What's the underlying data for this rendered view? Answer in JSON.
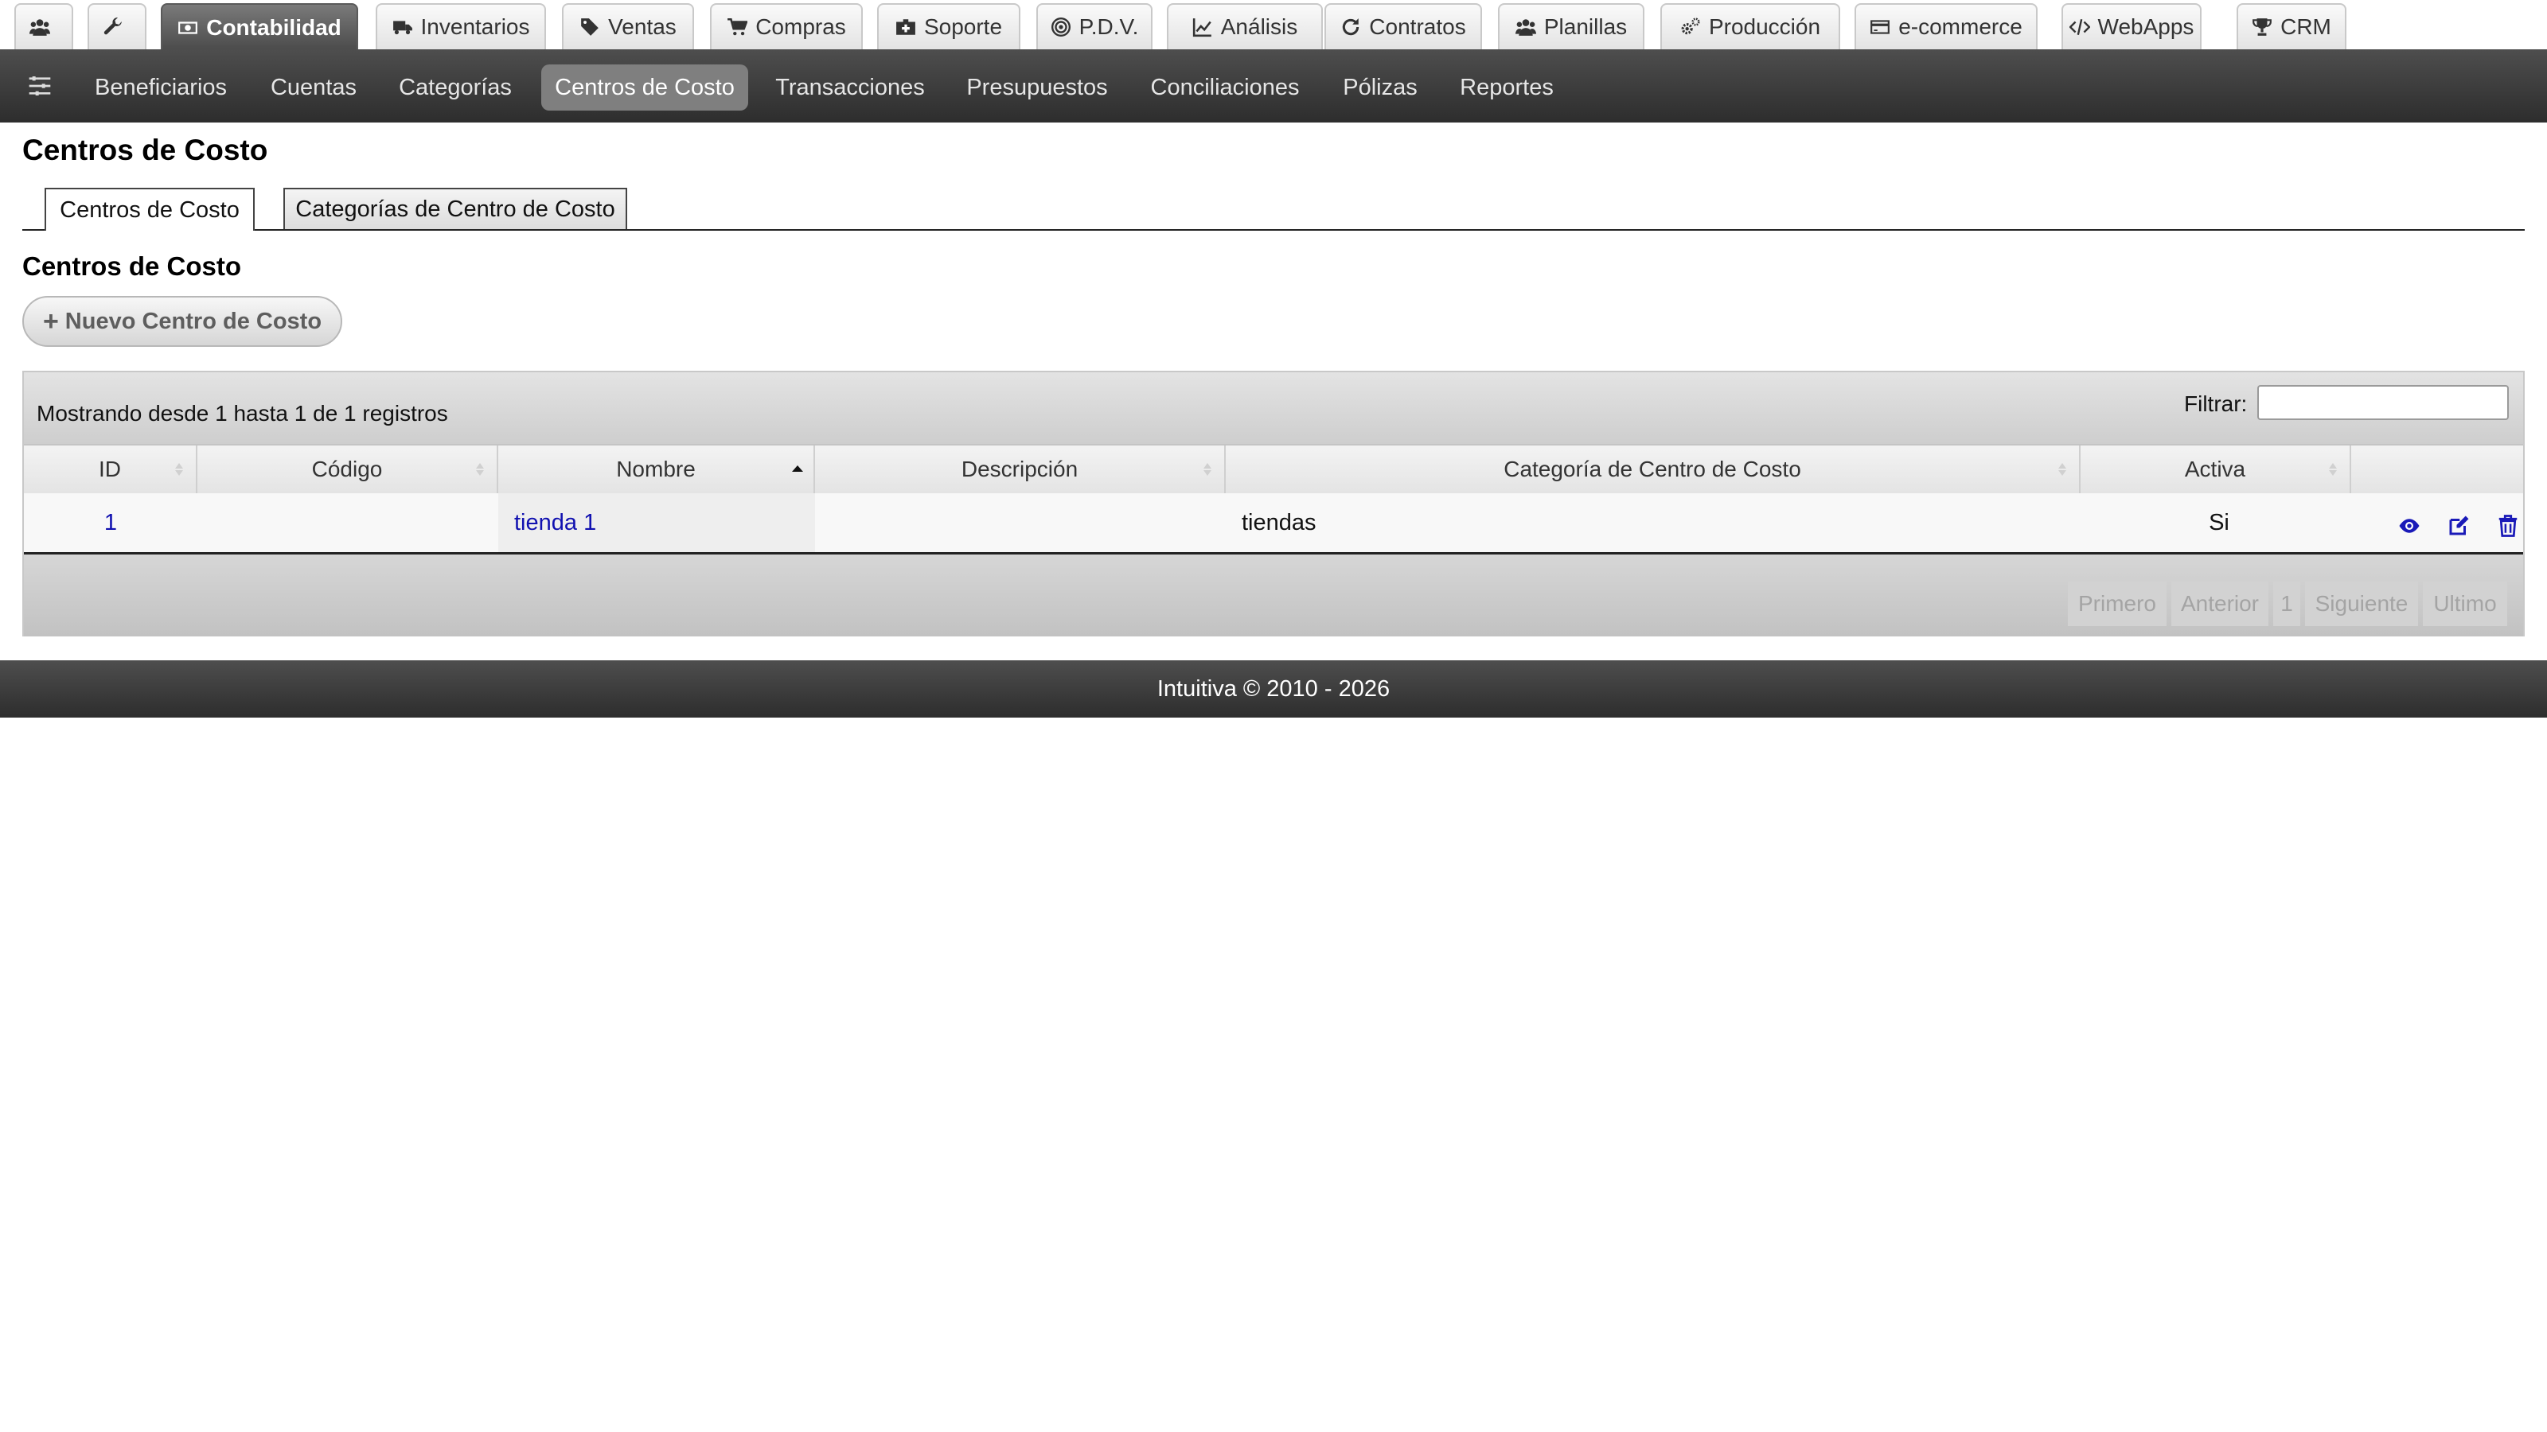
{
  "module_tabs": [
    {
      "label": "",
      "icon": "users-icon"
    },
    {
      "label": "",
      "icon": "wrench-icon"
    },
    {
      "label": "Contabilidad",
      "icon": "money-icon",
      "active": true
    },
    {
      "label": "Inventarios",
      "icon": "truck-icon"
    },
    {
      "label": "Ventas",
      "icon": "tags-icon"
    },
    {
      "label": "Compras",
      "icon": "cart-icon"
    },
    {
      "label": "Soporte",
      "icon": "medkit-icon"
    },
    {
      "label": "P.D.V.",
      "icon": "target-icon"
    },
    {
      "label": "Análisis",
      "icon": "line-chart-icon"
    },
    {
      "label": "Contratos",
      "icon": "refresh-icon"
    },
    {
      "label": "Planillas",
      "icon": "users-icon"
    },
    {
      "label": "Producción",
      "icon": "gears-icon"
    },
    {
      "label": "e-commerce",
      "icon": "credit-card-icon"
    },
    {
      "label": "WebApps",
      "icon": "code-icon"
    },
    {
      "label": "CRM",
      "icon": "trophy-icon"
    }
  ],
  "sub_nav": {
    "toggle_icon": "sliders-icon",
    "items": [
      {
        "label": "Beneficiarios"
      },
      {
        "label": "Cuentas"
      },
      {
        "label": "Categorías"
      },
      {
        "label": "Centros de Costo",
        "active": true
      },
      {
        "label": "Transacciones"
      },
      {
        "label": "Presupuestos"
      },
      {
        "label": "Conciliaciones"
      },
      {
        "label": "Pólizas"
      },
      {
        "label": "Reportes"
      }
    ]
  },
  "page": {
    "title": "Centros de Costo",
    "tabs": [
      {
        "label": "Centros de Costo",
        "active": true
      },
      {
        "label": "Categorías de Centro de Costo"
      }
    ],
    "section_title": "Centros de Costo",
    "new_button": {
      "icon": "plus-icon",
      "label": "Nuevo Centro de Costo"
    }
  },
  "table": {
    "info": "Mostrando desde 1 hasta 1 de 1 registros",
    "filter_label": "Filtrar:",
    "filter_value": "",
    "columns": [
      {
        "label": "ID",
        "sort": "both"
      },
      {
        "label": "Código",
        "sort": "both"
      },
      {
        "label": "Nombre",
        "sort": "asc"
      },
      {
        "label": "Descripción",
        "sort": "both"
      },
      {
        "label": "Categoría de Centro de Costo",
        "sort": "both"
      },
      {
        "label": "Activa",
        "sort": "both"
      },
      {
        "label": "",
        "sort": "none"
      }
    ],
    "rows": [
      {
        "id": "1",
        "codigo": "",
        "nombre": "tienda 1",
        "descripcion": "",
        "categoria": "tiendas",
        "activa": "Si",
        "actions": [
          "eye-icon",
          "edit-icon",
          "trash-icon"
        ]
      }
    ],
    "pagination": [
      "Primero",
      "Anterior",
      "1",
      "Siguiente",
      "Ultimo"
    ]
  },
  "footer": {
    "text": "Intuitiva © 2010 - 2026"
  },
  "colors": {
    "link": "#1010b0",
    "nav_dark": "#2d2d2d",
    "active_pill": "#7f7f7f"
  }
}
